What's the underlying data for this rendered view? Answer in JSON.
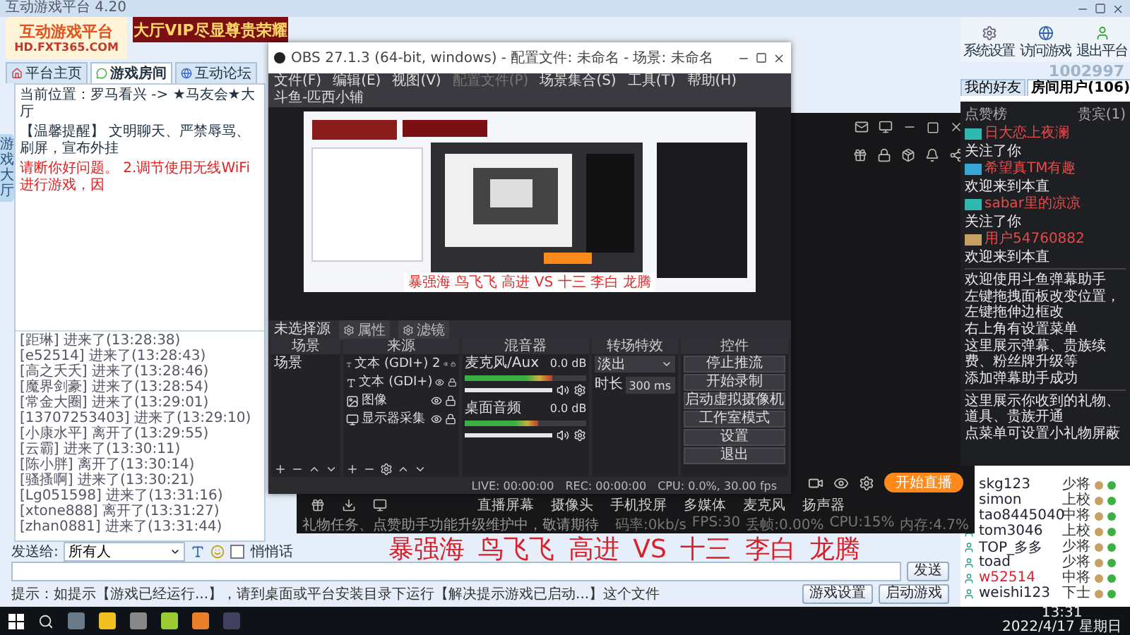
{
  "main_window": {
    "title": "互动游戏平台 4.20"
  },
  "banner": {
    "logo_title": "互动游戏平台",
    "logo_url": "HD.FXT365.COM",
    "ad": "大厅VIP尽显尊贵荣耀"
  },
  "toolbar": [
    "系统设置",
    "访问游戏",
    "退出平台"
  ],
  "user_id": "1002997",
  "nav_tabs": [
    {
      "label": "平台主页",
      "selected": false
    },
    {
      "label": "游戏房间",
      "selected": true
    },
    {
      "label": "互动论坛",
      "selected": false
    }
  ],
  "side_tab": "游戏大厅",
  "location": "当前位置：罗马看兴 -> ★马友会★大厅",
  "notice": "【温馨提醒】 文明聊天、严禁辱骂、刷屏，宣布外挂",
  "warning": "请断你好问题。 2.调节使用无线WiFi进行游戏，因",
  "chat_log": [
    "[距琳] 进来了(13:28:38)",
    "[e52514] 进来了(13:28:43)",
    "[高之夭夭] 进来了(13:28:46)",
    "[魔界剑豪] 进来了(13:28:54)",
    "[常金大圈] 进来了(13:29:01)",
    "[13707253403] 进来了(13:29:10)",
    "[小康水平] 离开了(13:29:55)",
    "[云霸] 进来了(13:30:11)",
    "[陈小胖] 离开了(13:30:14)",
    "[骚搔啊] 进来了(13:30:21)",
    "[Lg051598] 进来了(13:31:16)",
    "[xtone888] 离开了(13:31:27)",
    "[zhan0881] 进来了(13:31:44)"
  ],
  "chat_input": {
    "label": "发送给:",
    "value": "所有人",
    "whisper_label": "悄悄话",
    "whisper_checked": false,
    "send": "发送"
  },
  "tip": "提示：如提示【游戏已经运行...】，请到桌面或平台安装目录下运行【解决提示游戏已启动...】这个文件",
  "bottom_buttons": [
    "游戏设置",
    "启动游戏"
  ],
  "user_tabs": [
    {
      "label": "我的好友",
      "selected": false
    },
    {
      "label": "房间用户(106)",
      "selected": true
    }
  ],
  "users": [
    {
      "name": "skg123",
      "rank": "少将",
      "highlighted": false
    },
    {
      "name": "simon",
      "rank": "上校",
      "highlighted": false
    },
    {
      "name": "tao8445040",
      "rank": "中将",
      "highlighted": false
    },
    {
      "name": "tom3046",
      "rank": "上校",
      "highlighted": false
    },
    {
      "name": "TOP_多多",
      "rank": "少将",
      "highlighted": false
    },
    {
      "name": "toad",
      "rank": "少将",
      "highlighted": false
    },
    {
      "name": "w52514",
      "rank": "中将",
      "highlighted": true
    },
    {
      "name": "weishi123",
      "rank": "下士",
      "highlighted": false
    }
  ],
  "danmu": {
    "tabs": [
      "点赞榜",
      "贵宾(1)"
    ],
    "events": [
      {
        "color": "#2fb8b0",
        "name": "日大恋上夜澜",
        "text": "关注了你"
      },
      {
        "color": "#38a7d8",
        "name": "希望真TM有趣",
        "text": "欢迎来到本直"
      },
      {
        "color": "#2fb8b0",
        "name": "sabar里的凉凉",
        "text": "关注了你"
      },
      {
        "color": "#c9a064",
        "name": "用户54760882",
        "text": "欢迎来到本直"
      }
    ],
    "welcome": [
      "欢迎使用斗鱼弹幕助手",
      "左键拖拽面板改变位置，左键拖伸边框改",
      "右上角有设置菜单",
      "这里展示弹幕、贵族续费、粉丝牌升级等",
      "添加弹幕助手成功"
    ],
    "gift_hint": [
      "这里展示你收到的礼物、道具、贵族开通",
      "点菜单可设置小礼物屏蔽"
    ]
  },
  "obs": {
    "title": "OBS 27.1.3 (64-bit, windows) - 配置文件: 未命名 - 场景: 未命名",
    "menu": [
      {
        "label": "文件(F)",
        "disabled": false
      },
      {
        "label": "编辑(E)",
        "disabled": false
      },
      {
        "label": "视图(V)",
        "disabled": false
      },
      {
        "label": "配置文件(P)",
        "disabled": true
      },
      {
        "label": "场景集合(S)",
        "disabled": false
      },
      {
        "label": "工具(T)",
        "disabled": false
      },
      {
        "label": "帮助(H)",
        "disabled": false
      },
      {
        "label": "斗鱼-匹西小辅",
        "disabled": false
      }
    ],
    "preview_caption": "暴强海 鸟飞飞 高进 VS 十三 李白 龙腾",
    "source_bar": {
      "label": "未选择源",
      "buttons": [
        "属性",
        "滤镜"
      ]
    },
    "dock_titles": [
      "场景",
      "来源",
      "混音器",
      "转场特效",
      "控件"
    ],
    "scenes": [
      "场景"
    ],
    "sources": [
      {
        "name": "文本 (GDI+) 2",
        "kind": "text"
      },
      {
        "name": "文本 (GDI+)",
        "kind": "text"
      },
      {
        "name": "图像",
        "kind": "image"
      },
      {
        "name": "显示器采集",
        "kind": "display"
      }
    ],
    "mixer": [
      {
        "name": "麦克风/Aux",
        "reading": "0.0 dB",
        "meter": {
          "level": 0.72
        },
        "volume": {
          "level": 1
        }
      },
      {
        "name": "桌面音频",
        "reading": "0.0 dB",
        "meter": {
          "level": 0.6
        },
        "volume": {
          "level": 1
        }
      }
    ],
    "transition": {
      "value": "淡出",
      "duration_label": "时长",
      "duration": "300 ms"
    },
    "controls": [
      "停止推流",
      "开始录制",
      "启动虚拟摄像机",
      "工作室模式",
      "设置",
      "退出"
    ],
    "status": [
      "LIVE: 00:00:00",
      "REC: 00:00:00",
      "CPU: 0.0%, 30.00 fps"
    ]
  },
  "streamer": {
    "start_button": "开始直播",
    "tools": [
      "直播屏幕",
      "摄像头",
      "手机投屏",
      "多媒体",
      "麦克风",
      "扬声器"
    ],
    "notice": "礼物任务、点赞助手功能升级维护中，敬请期待",
    "stats": [
      "码率:0kb/s",
      "FPS:30",
      "丢帧:0.00%",
      "CPU:15%",
      "内存:4.7%"
    ]
  },
  "caption": "暴强海 鸟飞飞 高进 VS 十三 李白 龙腾",
  "taskbar": {
    "time": "13:31",
    "date": "2022/4/17 星期日"
  }
}
